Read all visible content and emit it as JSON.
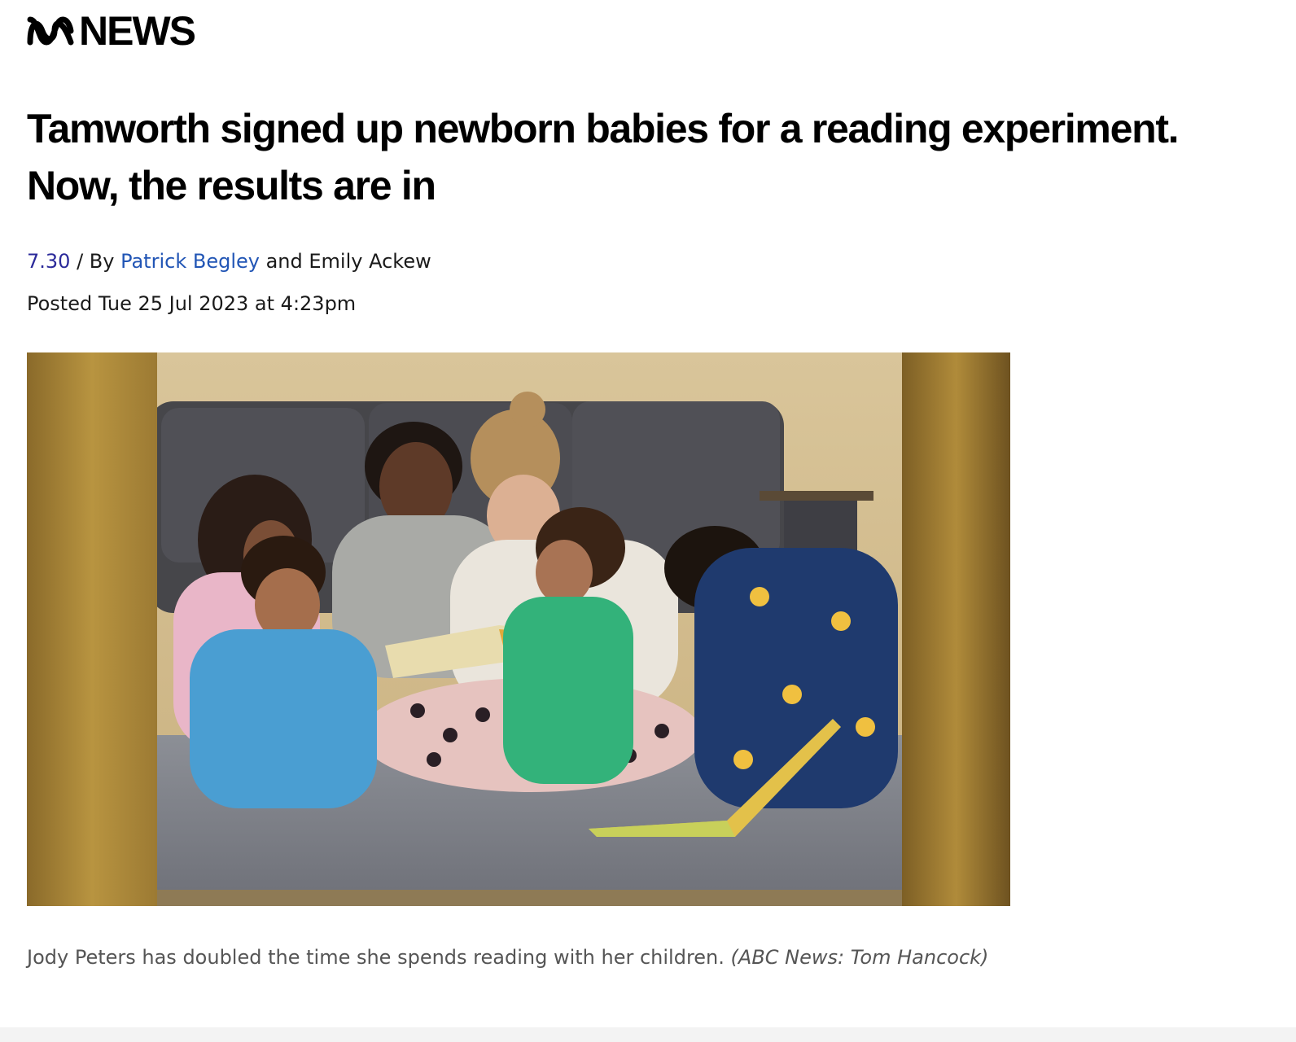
{
  "brand": {
    "logo_word": "NEWS"
  },
  "article": {
    "headline": "Tamworth signed up newborn babies for a reading experiment. Now, the results are in",
    "program": "7.30",
    "byline_sep": " / By ",
    "author_1": "Patrick Begley",
    "author_join": " and ",
    "author_2": "Emily Ackew",
    "posted": "Posted Tue 25 Jul 2023 at 4:23pm"
  },
  "image": {
    "caption": "Jody Peters has doubled the time she spends reading with her children.",
    "credit": "(ABC News: Tom Hancock)"
  },
  "colors": {
    "link": "#2155b5",
    "program_link": "#2b2a9a",
    "caption_text": "#555555"
  }
}
